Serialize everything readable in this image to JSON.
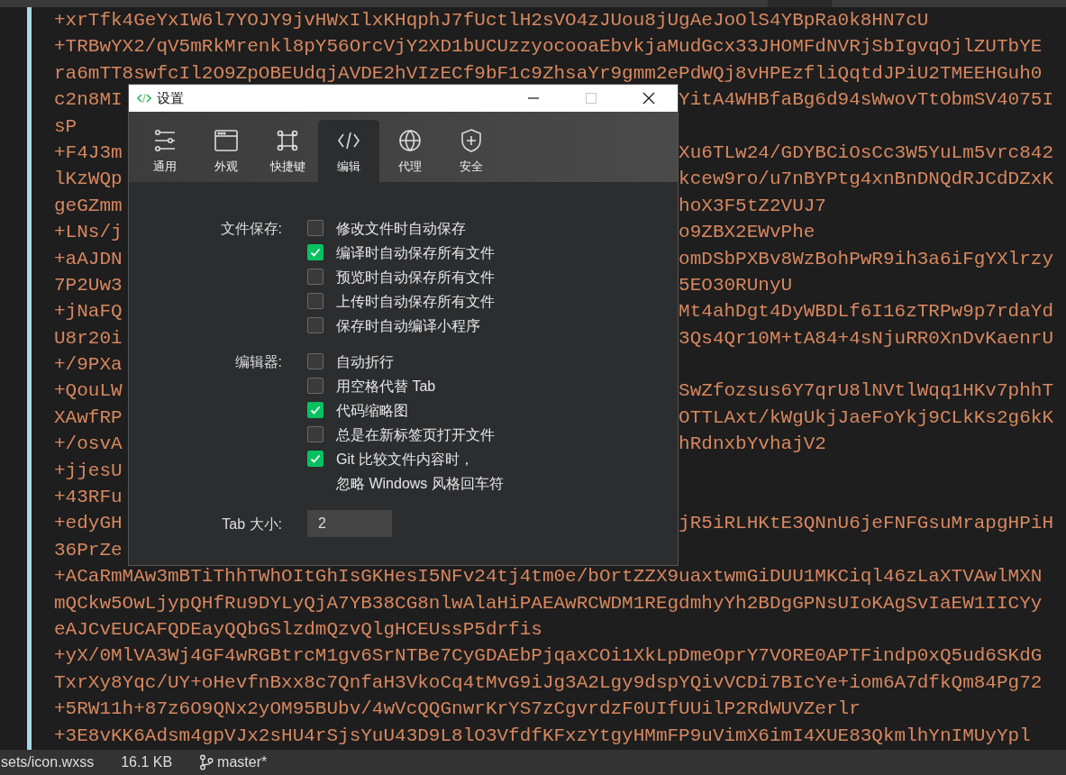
{
  "editor": {
    "lines": [
      {
        "left": "+xrTfk4GeYxIW6l7YOJY9jvHWxIlxKHqphJ7fUctlH2sVO4zJUou8jUgAeJoOlS4YBpRa0k8HN7cU"
      },
      {
        "left": "+TRBwYX2/qV5mRkMrenkl8pY56OrcVjY2XD1bUCUzzyocooaEbvkjaMudGcx33JHOMFdNVRjSbIgvqOjlZUTbYE"
      },
      {
        "left": "ra6mTT8swfcIl2O9ZpOBEUdqjAVDE2hVIzECf9bF1c9ZhsaYr9gmm2ePdWQj8vHPEzfliQqtdJPiU2TMEEHGuh0"
      },
      {
        "left": "c2n8MI",
        "right": "YitA4WHBfaBg6d94sWwovTtObmSV4075I"
      },
      {
        "left": "sP"
      },
      {
        "left": "+F4J3m",
        "right": "Xu6TLw24/GDYBCiOsCc3W5YuLm5vrc842"
      },
      {
        "left": "lKzWQp",
        "right": "kcew9ro/u7nBYPtg4xnBnDNQdRJCdDZxK"
      },
      {
        "left": "geGZmm",
        "right": "hoX3F5tZ2VUJ7"
      },
      {
        "left": "+LNs/j",
        "right": "o9ZBX2EWvPhe"
      },
      {
        "left": "+aAJDN",
        "right": "omDSbPXBv8WzBohPwR9ih3a6iFgYXlrzy"
      },
      {
        "left": "7P2Uw3",
        "right": "5EO30RUnyU"
      },
      {
        "left": "+jNaFQ",
        "right": "Mt4ahDgt4DyWBDLf6I16zTRPw9p7rdaYd"
      },
      {
        "left": "U8r20i",
        "right": "3Qs4Qr10M+tA84+4sNjuRR0XnDvKaenrU"
      },
      {
        "left": "+/9PXa"
      },
      {
        "left": "+QouLW",
        "right": "SwZfozsus6Y7qrU8lNVtlWqq1HKv7phhT"
      },
      {
        "left": "XAwfRP",
        "right": "OTTLAxt/kWgUkjJaeFoYkj9CLkKs2g6kK"
      },
      {
        "left": "+/osvA",
        "right": "hRdnxbYvhajV2"
      },
      {
        "left": "+jjesU"
      },
      {
        "left": "+43RFu"
      },
      {
        "left": "+edyGH",
        "right": "jR5iRLHKtE3QNnU6jeFNFGsuMrapgHPiH"
      },
      {
        "left": "36PrZe"
      },
      {
        "left": "+ACaRmMAw3mBTiThhTWhOItGhIsGKHesI5NFv24tj4tm0e/bOrtZZX9uaxtwmGiDUU1MKCiql46zLaXTVAwlMXN"
      },
      {
        "left": "mQCkw5OwLjypQHfRu9DYLyQjA7YB38CG8nlwAlaHiPAEAwRCWDM1REgdmhyYh2BDgGPNsUIoKAgSvIaEW1IICYy"
      },
      {
        "left": "eAJCvEUCAFQDEayQQbGSlzdmQzvQlgHCEUssP5drfis"
      },
      {
        "left": "+yX/0MlVA3Wj4GF4wRGBtrcM1gv6SrNTBe7CyGDAEbPjqaxCOi1XkLpDmeOprY7VORE0APTFindp0xQ5ud6SKdG"
      },
      {
        "left": "TxrXy8Yqc/UY+oHevfnBxx8c7QnfaH3VkoCq4tMvG9iJg3A2Lgy9dspYQivVCDi7BIcYe+iom6A7dfkQm84Pg72"
      },
      {
        "left": "+5RW11h+87z6O9QNx2yOM95BUbv/4wVcQQGnwrKrYS7zCgvrdzF0UIfUUilP2RdWUVZerlr"
      },
      {
        "left": "+3E8vKK6Adsm4gpVJx2sHU4rSjsYuU43D9L8lO3VfdfKFxzYtgyHMmFP9uVimX6imI4XUE83QkmlhYnIMUyYpl"
      }
    ]
  },
  "dialog": {
    "title": "设置",
    "tabs": [
      {
        "label": "通用",
        "selected": false
      },
      {
        "label": "外观",
        "selected": false
      },
      {
        "label": "快捷键",
        "selected": false
      },
      {
        "label": "编辑",
        "selected": true
      },
      {
        "label": "代理",
        "selected": false
      },
      {
        "label": "安全",
        "selected": false
      }
    ],
    "sections": [
      {
        "label": "文件保存:",
        "options": [
          {
            "label": "修改文件时自动保存",
            "checked": false
          },
          {
            "label": "编译时自动保存所有文件",
            "checked": true
          },
          {
            "label": "预览时自动保存所有文件",
            "checked": false
          },
          {
            "label": "上传时自动保存所有文件",
            "checked": false
          },
          {
            "label": "保存时自动编译小程序",
            "checked": false
          }
        ]
      },
      {
        "label": "编辑器:",
        "options": [
          {
            "label": "自动折行",
            "checked": false
          },
          {
            "label": "用空格代替 Tab",
            "checked": false
          },
          {
            "label": "代码缩略图",
            "checked": true
          },
          {
            "label": "总是在新标签页打开文件",
            "checked": false
          },
          {
            "label": "Git 比较文件内容时，",
            "second_line": "忽略 Windows 风格回车符",
            "checked": true
          }
        ]
      }
    ],
    "tab_size": {
      "label": "Tab 大小:",
      "value": "2"
    }
  },
  "status_bar": {
    "path": "sets/icon.wxss",
    "size": "16.1 KB",
    "branch": "master*"
  }
}
